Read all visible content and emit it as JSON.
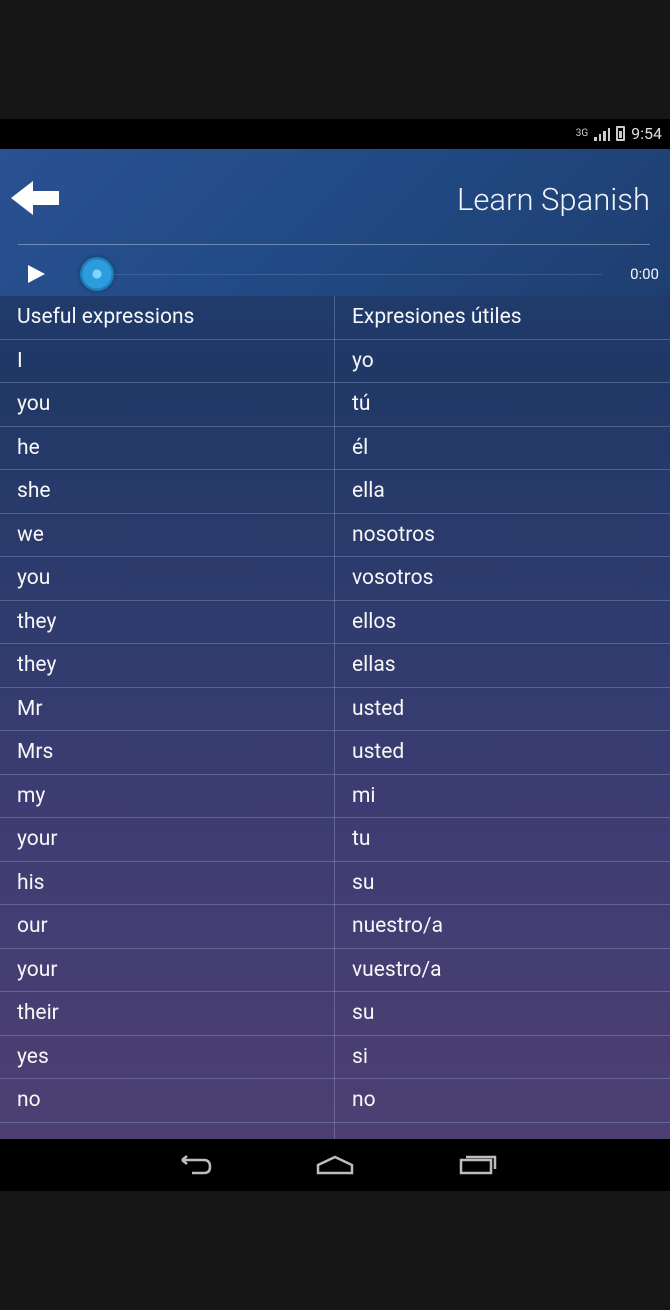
{
  "status_bar": {
    "time": "9:54",
    "network": "3G"
  },
  "app": {
    "title": "Learn Spanish",
    "player": {
      "time": "0:00"
    }
  },
  "table": {
    "header": {
      "left": "Useful expressions",
      "right": "Expresiones útiles"
    },
    "rows": [
      {
        "en": "I",
        "es": "yo"
      },
      {
        "en": "you",
        "es": "tú"
      },
      {
        "en": "he",
        "es": "él"
      },
      {
        "en": "she",
        "es": "ella"
      },
      {
        "en": "we",
        "es": "nosotros"
      },
      {
        "en": "you",
        "es": "vosotros"
      },
      {
        "en": "they",
        "es": "ellos"
      },
      {
        "en": "they",
        "es": "ellas"
      },
      {
        "en": "Mr",
        "es": "usted"
      },
      {
        "en": "Mrs",
        "es": "usted"
      },
      {
        "en": "my",
        "es": "mi"
      },
      {
        "en": "your",
        "es": "tu"
      },
      {
        "en": "his",
        "es": "su"
      },
      {
        "en": "our",
        "es": "nuestro/a"
      },
      {
        "en": "your",
        "es": "vuestro/a"
      },
      {
        "en": "their",
        "es": "su"
      },
      {
        "en": "yes",
        "es": "si"
      },
      {
        "en": "no",
        "es": "no"
      }
    ]
  },
  "icons": {
    "back": "arrow-left-icon",
    "play": "play-icon",
    "nav_back": "back-icon",
    "nav_home": "home-icon",
    "nav_recent": "recent-apps-icon"
  }
}
